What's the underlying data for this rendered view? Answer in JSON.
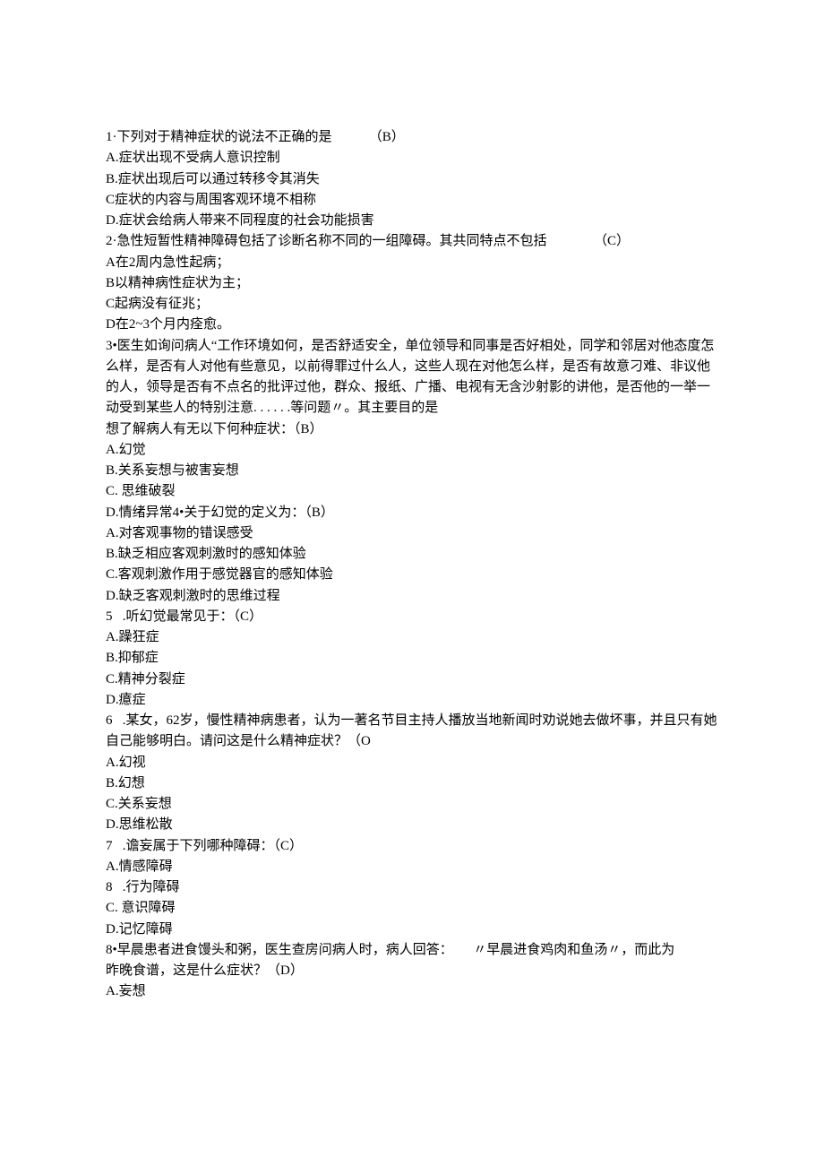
{
  "lines": [
    "1·下列对于精神症状的说法不正确的是           （B）",
    "A.症状出现不受病人意识控制",
    "B.症状出现后可以通过转移令其消失",
    "C症状的内容与周围客观环境不相称",
    "D.症状会给病人带来不同程度的社会功能损害",
    "2·急性短暂性精神障碍包括了诊断名称不同的一组障碍。其共同特点不包括              （C）",
    "A在2周内急性起病；",
    "B以精神病性症状为主；",
    "C起病没有征兆；",
    "D在2~3个月内痊愈。",
    "3•医生如询问病人“工作环境如何，是否舒适安全，单位领导和同事是否好相处，同学和邻居对他态度怎么样，是否有人对他有些意见，以前得罪过什么人，这些人现在对他怎么样，是否有故意刁难、非议他的人，领导是否有不点名的批评过他，群众、报纸、广播、电视有无含沙射影的讲他，是否他的一举一动受到某些人的特别注意. . . . . .等问题〃。其主要目的是",
    "想了解病人有无以下何种症状：（B）",
    "A.幻觉",
    "B.关系妄想与被害妄想",
    "C. 思维破裂",
    "D.情绪异常4•关于幻觉的定义为：（B）",
    "A.对客观事物的错误感受",
    "B.缺乏相应客观刺激时的感知体验",
    "C.客观刺激作用于感觉器官的感知体验",
    "D.缺乏客观刺激时的思维过程",
    "5   .听幻觉最常见于：（C）",
    "A.躁狂症",
    "B.抑郁症",
    "C.精神分裂症",
    "D.癔症",
    "6   .某女，62岁，慢性精神病患者，认为一著名节目主持人播放当地新闻时劝说她去做坏事，并且只有她自己能够明白。请问这是什么精神症状？（O",
    "A.幻视",
    "B.幻想",
    "C.关系妄想",
    "D.思维松散",
    "7   .谵妄属于下列哪种障碍：（C）",
    "A.情感障碍",
    "8   .行为障碍",
    "C. 意识障碍",
    "D.记忆障碍",
    "8•早晨患者进食馒头和粥，医生查房问病人时，病人回答：      〃早晨进食鸡肉和鱼汤〃，而此为",
    "昨晚食谱，这是什么症状？（D）",
    "A.妄想"
  ]
}
